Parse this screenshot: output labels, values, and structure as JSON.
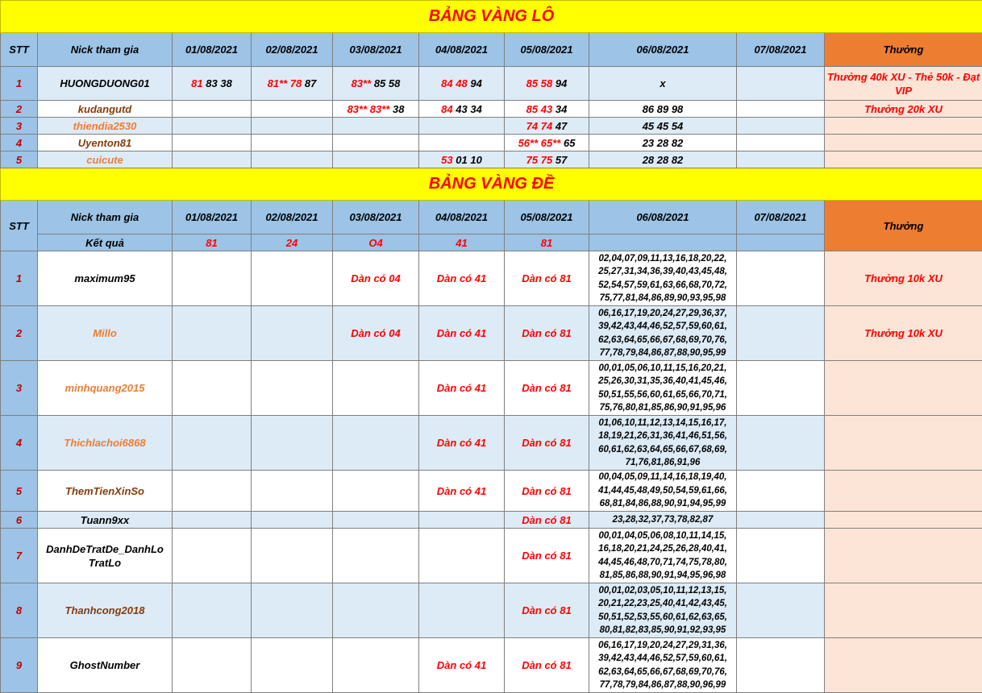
{
  "lo": {
    "title": "BẢNG VÀNG LÔ",
    "headers": {
      "stt": "STT",
      "nick": "Nick tham gia",
      "d1": "01/08/2021",
      "d2": "02/08/2021",
      "d3": "03/08/2021",
      "d4": "04/08/2021",
      "d5": "05/08/2021",
      "d6": "06/08/2021",
      "d7": "07/08/2021",
      "reward": "Thưởng"
    },
    "rows": [
      {
        "stt": "1",
        "nick": "HUONGDUONG01",
        "nick_color": "black",
        "d1": [
          {
            "t": "81",
            "c": "red"
          },
          {
            "t": "83 38",
            "c": "blk"
          }
        ],
        "d2": [
          {
            "t": "81** 78",
            "c": "red"
          },
          {
            "t": "87",
            "c": "blk"
          }
        ],
        "d3": [
          {
            "t": "83**",
            "c": "red"
          },
          {
            "t": "85 58",
            "c": "blk"
          }
        ],
        "d4": [
          {
            "t": "84 48",
            "c": "red"
          },
          {
            "t": "94",
            "c": "blk"
          }
        ],
        "d5": [
          {
            "t": "85 58",
            "c": "red"
          },
          {
            "t": "94",
            "c": "blk"
          }
        ],
        "d6": [
          {
            "t": "x",
            "c": "blk"
          }
        ],
        "d7": [],
        "reward": "Thưởng 40k XU - Thẻ 50k - Đạt VIP"
      },
      {
        "stt": "2",
        "nick": "kudangutd",
        "nick_color": "brown",
        "d1": [],
        "d2": [],
        "d3": [
          {
            "t": "83** 83**",
            "c": "red"
          },
          {
            "t": "38",
            "c": "blk"
          }
        ],
        "d4": [
          {
            "t": "84",
            "c": "red"
          },
          {
            "t": "43 34",
            "c": "blk"
          }
        ],
        "d5": [
          {
            "t": "85  43",
            "c": "red"
          },
          {
            "t": "34",
            "c": "blk"
          }
        ],
        "d6": [
          {
            "t": "86 89 98",
            "c": "blk"
          }
        ],
        "d7": [],
        "reward": "Thưởng 20k XU"
      },
      {
        "stt": "3",
        "nick": "thiendia2530",
        "nick_color": "orange",
        "d1": [],
        "d2": [],
        "d3": [],
        "d4": [],
        "d5": [
          {
            "t": "74 74",
            "c": "red"
          },
          {
            "t": "47",
            "c": "blk"
          }
        ],
        "d6": [
          {
            "t": "45 45 54",
            "c": "blk"
          }
        ],
        "d7": [],
        "reward": ""
      },
      {
        "stt": "4",
        "nick": "Uyenton81",
        "nick_color": "brown",
        "d1": [],
        "d2": [],
        "d3": [],
        "d4": [],
        "d5": [
          {
            "t": "56** 65**",
            "c": "red"
          },
          {
            "t": "65",
            "c": "blk"
          }
        ],
        "d6": [
          {
            "t": "23 28 82",
            "c": "blk"
          }
        ],
        "d7": [],
        "reward": ""
      },
      {
        "stt": "5",
        "nick": "cuicute",
        "nick_color": "orange",
        "d1": [],
        "d2": [],
        "d3": [],
        "d4": [
          {
            "t": "53",
            "c": "red"
          },
          {
            "t": "01 10",
            "c": "blk"
          }
        ],
        "d5": [
          {
            "t": "75 75",
            "c": "red"
          },
          {
            "t": "57",
            "c": "blk"
          }
        ],
        "d6": [
          {
            "t": "28 28 82",
            "c": "blk"
          }
        ],
        "d7": [],
        "reward": ""
      }
    ]
  },
  "de": {
    "title": "BẢNG VÀNG ĐỀ",
    "headers": {
      "stt": "STT",
      "nick": "Nick tham gia",
      "d1": "01/08/2021",
      "d2": "02/08/2021",
      "d3": "03/08/2021",
      "d4": "04/08/2021",
      "d5": "05/08/2021",
      "d6": "06/08/2021",
      "d7": "07/08/2021",
      "reward": "Thưởng"
    },
    "results": {
      "label": "Kết quả",
      "d1": "81",
      "d2": "24",
      "d3": "O4",
      "d4": "41",
      "d5": "81"
    },
    "rows": [
      {
        "stt": "1",
        "nick": "maximum95",
        "nick_color": "black",
        "d1": "",
        "d2": "",
        "d3": "Dàn có 04",
        "d4": "Dàn có 41",
        "d5": "Dàn có 81",
        "d6": "02,04,07,09,11,13,16,18,20,22, 25,27,31,34,36,39,40,43,45,48, 52,54,57,59,61,63,66,68,70,72, 75,77,81,84,86,89,90,93,95,98",
        "d7": "",
        "reward": "Thưởng 10k XU"
      },
      {
        "stt": "2",
        "nick": "Millo",
        "nick_color": "orange",
        "d1": "",
        "d2": "",
        "d3": "Dàn có 04",
        "d4": "Dàn có 41",
        "d5": "Dàn có 81",
        "d6": "06,16,17,19,20,24,27,29,36,37, 39,42,43,44,46,52,57,59,60,61, 62,63,64,65,66,67,68,69,70,76, 77,78,79,84,86,87,88,90,95,99",
        "d7": "",
        "reward": "Thưởng 10k XU"
      },
      {
        "stt": "3",
        "nick": "minhquang2015",
        "nick_color": "orange",
        "d1": "",
        "d2": "",
        "d3": "",
        "d4": "Dàn có 41",
        "d5": "Dàn có 81",
        "d6": "00,01,05,06,10,11,15,16,20,21, 25,26,30,31,35,36,40,41,45,46, 50,51,55,56,60,61,65,66,70,71, 75,76,80,81,85,86,90,91,95,96",
        "d7": "",
        "reward": ""
      },
      {
        "stt": "4",
        "nick": "Thichlachoi6868",
        "nick_color": "orange",
        "d1": "",
        "d2": "",
        "d3": "",
        "d4": "Dàn có 41",
        "d5": "Dàn có 81",
        "d6": "01,06,10,11,12,13,14,15,16,17, 18,19,21,26,31,36,41,46,51,56, 60,61,62,63,64,65,66,67,68,69, 71,76,81,86,91,96",
        "d7": "",
        "reward": ""
      },
      {
        "stt": "5",
        "nick": "ThemTienXinSo",
        "nick_color": "brown",
        "d1": "",
        "d2": "",
        "d3": "",
        "d4": "Dàn có 41",
        "d5": "Dàn có 81",
        "d6": "00,04,05,09,11,14,16,18,19,40, 41,44,45,48,49,50,54,59,61,66, 68,81,84,86,88,90,91,94,95,99",
        "d7": "",
        "reward": ""
      },
      {
        "stt": "6",
        "nick": "Tuann9xx",
        "nick_color": "black",
        "d1": "",
        "d2": "",
        "d3": "",
        "d4": "",
        "d5": "Dàn có 81",
        "d6": "23,28,32,37,73,78,82,87",
        "d7": "",
        "reward": ""
      },
      {
        "stt": "7",
        "nick": "DanhDeTratDe_DanhLo TratLo",
        "nick_color": "black",
        "d1": "",
        "d2": "",
        "d3": "",
        "d4": "",
        "d5": "Dàn có 81",
        "d6": "00,01,04,05,06,08,10,11,14,15, 16,18,20,21,24,25,26,28,40,41, 44,45,46,48,70,71,74,75,78,80, 81,85,86,88,90,91,94,95,96,98",
        "d7": "",
        "reward": ""
      },
      {
        "stt": "8",
        "nick": "Thanhcong2018",
        "nick_color": "brown",
        "d1": "",
        "d2": "",
        "d3": "",
        "d4": "",
        "d5": "Dàn có 81",
        "d6": "00,01,02,03,05,10,11,12,13,15, 20,21,22,23,25,40,41,42,43,45, 50,51,52,53,55,60,61,62,63,65, 80,81,82,83,85,90,91,92,93,95",
        "d7": "",
        "reward": ""
      },
      {
        "stt": "9",
        "nick": "GhostNumber",
        "nick_color": "black",
        "d1": "",
        "d2": "",
        "d3": "",
        "d4": "Dàn có 41",
        "d5": "Dàn có 81",
        "d6": "06,16,17,19,20,24,27,29,31,36, 39,42,43,44,46,52,57,59,60,61, 62,63,64,65,66,67,68,69,70,76, 77,78,79,84,86,87,88,90,96,99",
        "d7": "",
        "reward": ""
      }
    ]
  },
  "colors": {
    "title_bg": "#ffff00",
    "title_text": "#ff0000",
    "header_bg": "#9dc3e6",
    "reward_header_bg": "#ed7d31",
    "reward_bg": "#fce4d6",
    "row_alt_bg": "#ddebf7",
    "stt_text": "#c00000",
    "orange_nick": "#ed7d31",
    "brown_nick": "#843c0c"
  }
}
